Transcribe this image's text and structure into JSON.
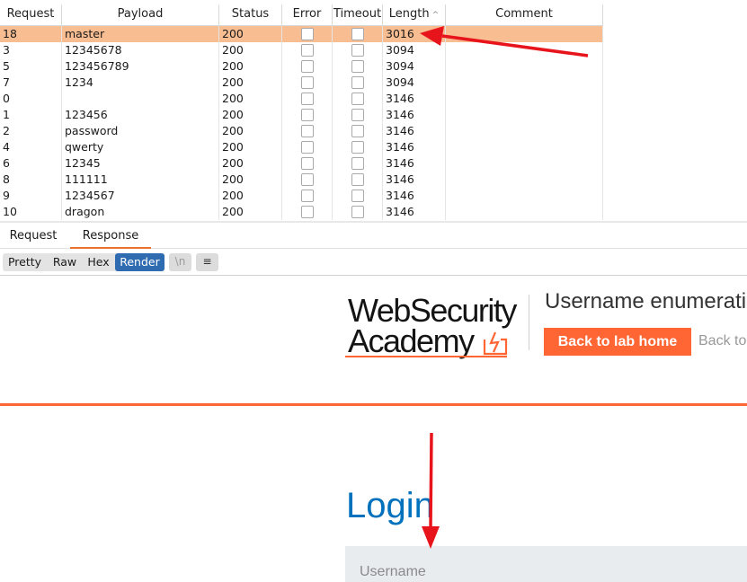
{
  "table": {
    "columns": [
      {
        "key": "request",
        "label": "Request"
      },
      {
        "key": "payload",
        "label": "Payload"
      },
      {
        "key": "status",
        "label": "Status"
      },
      {
        "key": "error",
        "label": "Error"
      },
      {
        "key": "timeout",
        "label": "Timeout"
      },
      {
        "key": "length",
        "label": "Length"
      },
      {
        "key": "comment",
        "label": "Comment"
      }
    ],
    "sort_indicator": "^",
    "rows": [
      {
        "request": "18",
        "payload": "master",
        "status": "200",
        "length": "3016",
        "selected": true
      },
      {
        "request": "3",
        "payload": "12345678",
        "status": "200",
        "length": "3094"
      },
      {
        "request": "5",
        "payload": "123456789",
        "status": "200",
        "length": "3094"
      },
      {
        "request": "7",
        "payload": "1234",
        "status": "200",
        "length": "3094"
      },
      {
        "request": "0",
        "payload": "",
        "status": "200",
        "length": "3146"
      },
      {
        "request": "1",
        "payload": "123456",
        "status": "200",
        "length": "3146"
      },
      {
        "request": "2",
        "payload": "password",
        "status": "200",
        "length": "3146"
      },
      {
        "request": "4",
        "payload": "qwerty",
        "status": "200",
        "length": "3146"
      },
      {
        "request": "6",
        "payload": "12345",
        "status": "200",
        "length": "3146"
      },
      {
        "request": "8",
        "payload": "111111",
        "status": "200",
        "length": "3146"
      },
      {
        "request": "9",
        "payload": "1234567",
        "status": "200",
        "length": "3146"
      },
      {
        "request": "10",
        "payload": "dragon",
        "status": "200",
        "length": "3146"
      }
    ]
  },
  "tabs": [
    {
      "label": "Request",
      "active": false
    },
    {
      "label": "Response",
      "active": true
    }
  ],
  "view_modes": [
    {
      "label": "Pretty",
      "active": false
    },
    {
      "label": "Raw",
      "active": false
    },
    {
      "label": "Hex",
      "active": false
    },
    {
      "label": "Render",
      "active": true
    }
  ],
  "view_icons": {
    "newline": "\\n",
    "menu": "≡"
  },
  "render": {
    "logo_line1": "WebSecurity",
    "logo_line2": "Academy",
    "lab_title": "Username enumeratio",
    "back_button": "Back to lab home",
    "back_link": "Back to",
    "login_heading": "Login",
    "username_label": "Username"
  },
  "colors": {
    "selected_row": "#f9bd92",
    "accent_orange": "#ff6633",
    "render_active": "#2f6bb0",
    "login_blue": "#0071bc",
    "arrow_red": "#e8141c"
  }
}
